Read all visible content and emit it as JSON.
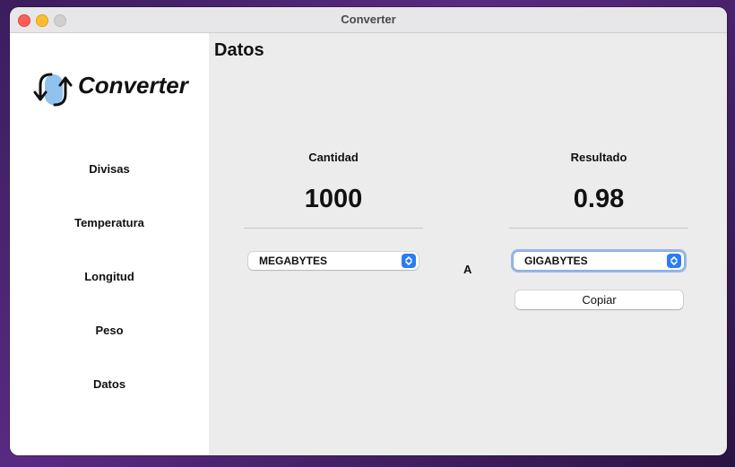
{
  "window": {
    "title": "Converter"
  },
  "sidebar": {
    "logo_text": "Converter",
    "items": [
      {
        "label": "Divisas"
      },
      {
        "label": "Temperatura"
      },
      {
        "label": "Longitud"
      },
      {
        "label": "Peso"
      },
      {
        "label": "Datos"
      }
    ]
  },
  "main": {
    "title": "Datos",
    "input": {
      "label": "Cantidad",
      "value": "1000",
      "unit": "MEGABYTES"
    },
    "separator": "A",
    "output": {
      "label": "Resultado",
      "value": "0.98",
      "unit": "GIGABYTES"
    },
    "copy_label": "Copiar"
  },
  "colors": {
    "accent": "#2b7cf6",
    "sidebar_bg": "#ffffff",
    "content_bg": "#ececec"
  }
}
